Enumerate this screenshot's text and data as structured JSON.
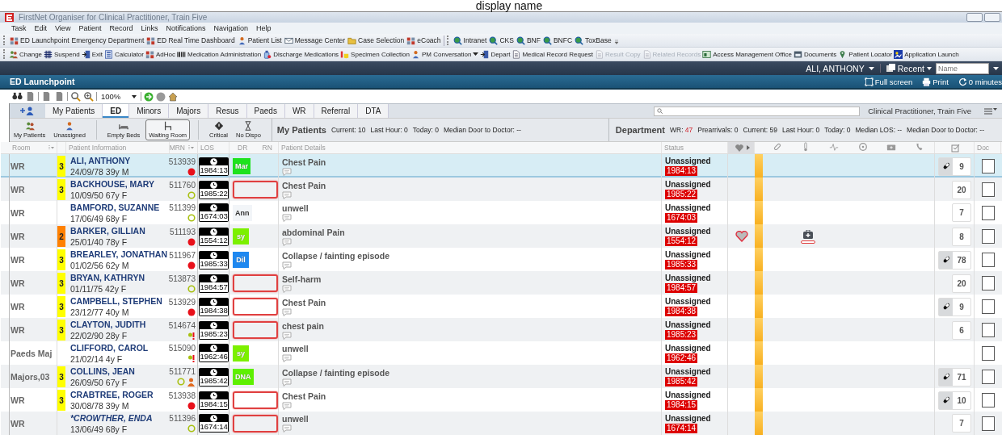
{
  "overlay_text": "display name",
  "window": {
    "title": "FirstNet Organiser for Clinical Practitioner, Train Five"
  },
  "menu": [
    "Task",
    "Edit",
    "View",
    "Patient",
    "Record",
    "Links",
    "Notifications",
    "Navigation",
    "Help"
  ],
  "toolbar_1": [
    {
      "items": [
        {
          "label": "ED Launchpoint",
          "kind": "grid"
        },
        {
          "label": "Emergency Department",
          "kind": "none"
        },
        {
          "label": "ED Real Time Dashboard",
          "kind": "grid"
        },
        {
          "label": "Patient List",
          "kind": "person"
        },
        {
          "label": "Message Center",
          "kind": "mail"
        },
        {
          "label": "Case Selection",
          "kind": "folder"
        },
        {
          "label": "eCoach",
          "kind": "grid"
        }
      ]
    },
    {
      "items": [
        {
          "label": "Intranet",
          "kind": "globe"
        },
        {
          "label": "CKS",
          "kind": "globe"
        },
        {
          "label": "BNF",
          "kind": "globe"
        },
        {
          "label": "BNFC",
          "kind": "globe"
        },
        {
          "label": "ToxBase",
          "kind": "globe"
        }
      ]
    }
  ],
  "toolbar_2": [
    {
      "label": "Change",
      "kind": "people",
      "disabled": false
    },
    {
      "label": "Suspend",
      "kind": "hash",
      "disabled": false
    },
    {
      "label": "Exit",
      "kind": "door",
      "disabled": false
    },
    {
      "label": "Calculator",
      "kind": "calculator",
      "disabled": false
    },
    {
      "label": "AdHoc",
      "kind": "grid",
      "disabled": false
    },
    {
      "label": "Medication Administration",
      "kind": "barcode",
      "disabled": false
    },
    {
      "label": "Discharge Medications",
      "kind": "bottle",
      "disabled": false
    },
    {
      "label": "Specimen Collection",
      "kind": "tube",
      "disabled": false
    },
    {
      "label": "PM Conversation",
      "kind": "person",
      "disabled": false,
      "dropdown": true
    },
    {
      "label": "Depart",
      "kind": "door",
      "disabled": false
    },
    {
      "label": "Medical Record Request",
      "kind": "document",
      "disabled": false
    },
    {
      "label": "Result Copy",
      "kind": "document",
      "disabled": true
    },
    {
      "label": "Related Records",
      "kind": "document",
      "disabled": true
    },
    {
      "label": "Access Management Office",
      "kind": "window",
      "disabled": false
    },
    {
      "label": "Documents",
      "kind": "drawer",
      "disabled": false
    },
    {
      "label": "Patient Locator",
      "kind": "pin",
      "disabled": false
    },
    {
      "label": "Application Launch",
      "kind": "tile",
      "disabled": false
    }
  ],
  "user_bar": {
    "user": "ALI, ANTHONY",
    "recent": "Recent",
    "search": {
      "placeholder": "Name"
    }
  },
  "view": {
    "title": "ED Launchpoint",
    "actions": [
      {
        "label": "Full screen",
        "kind": "fullscreen"
      },
      {
        "label": "Print",
        "kind": "print"
      },
      {
        "label": "0 minutes",
        "kind": "refresh"
      }
    ]
  },
  "zoom": "100%",
  "tabs": [
    {
      "label": "My Patients",
      "selected": false
    },
    {
      "label": "ED",
      "selected": true
    },
    {
      "label": "Minors",
      "selected": false
    },
    {
      "label": "Majors",
      "selected": false
    },
    {
      "label": "Resus",
      "selected": false
    },
    {
      "label": "Paeds",
      "selected": false
    },
    {
      "label": "WR",
      "selected": false
    },
    {
      "label": "Referral",
      "selected": false
    },
    {
      "label": "DTA",
      "selected": false
    }
  ],
  "account": "Clinical Practitioner, Train Five",
  "filters": [
    {
      "items": [
        {
          "label": "My Patients",
          "kind": "people",
          "selected": false
        },
        {
          "label": "Unassigned",
          "kind": "person",
          "selected": false
        }
      ]
    },
    {
      "items": [
        {
          "label": "Empty Beds",
          "kind": "bed",
          "selected": false
        },
        {
          "label": "Waiting Room",
          "kind": "chair",
          "selected": true
        }
      ]
    },
    {
      "items": [
        {
          "label": "Critical",
          "kind": "diamond",
          "selected": false
        },
        {
          "label": "No Dispo",
          "kind": "hourglass",
          "selected": false
        }
      ]
    }
  ],
  "my_patients": {
    "title": "My Patients",
    "stats": [
      {
        "label": "Current:",
        "value": "10",
        "alert": false
      },
      {
        "label": "Last Hour:",
        "value": "0",
        "alert": false
      },
      {
        "label": "Today:",
        "value": "0",
        "alert": false
      },
      {
        "label": "Median Door to Doctor:",
        "value": "--",
        "alert": false
      }
    ]
  },
  "department": {
    "title": "Department",
    "stats": [
      {
        "label": "WR:",
        "value": "47",
        "alert": true
      },
      {
        "label": "Prearrivals:",
        "value": "0",
        "alert": false
      },
      {
        "label": "Current:",
        "value": "59",
        "alert": false
      },
      {
        "label": "Last Hour:",
        "value": "0",
        "alert": false
      },
      {
        "label": "Today:",
        "value": "0",
        "alert": false
      },
      {
        "label": "Median LOS:",
        "value": "--",
        "alert": false
      },
      {
        "label": "Median Door to Doctor:",
        "value": "--",
        "alert": false
      }
    ]
  },
  "columns": {
    "room": "Room",
    "patient": "Patient Information",
    "mrn": "MRN",
    "los": "LOS",
    "dr": "DR",
    "rn": "RN",
    "details": "Patient Details",
    "status": "Status",
    "doc": "Doc"
  },
  "rows": [
    {
      "room": "WR",
      "acuity": {
        "label": "3",
        "color": "#ffff00"
      },
      "name": "ALI, ANTHONY",
      "italic": false,
      "dob": "24/09/78 39y M",
      "mrn": "513939",
      "indicators": [
        {
          "kind": "dot"
        }
      ],
      "los": "1984:13",
      "dr": {
        "kind": "tag",
        "label": "Mar",
        "color": "#1ee21e"
      },
      "complaint": "Chest Pain",
      "status": "Unassigned",
      "status_time": "1984:13",
      "heart": false,
      "kit": false,
      "count": {
        "label": "9",
        "pill": true
      },
      "doc_checked": false,
      "selected": true
    },
    {
      "room": "WR",
      "acuity": {
        "label": "3",
        "color": "#ffff00"
      },
      "name": "BACKHOUSE, MARY",
      "italic": false,
      "dob": "10/09/50 67y F",
      "mrn": "511760",
      "indicators": [
        {
          "kind": "ring"
        }
      ],
      "los": "1985:22",
      "dr": {
        "kind": "empty"
      },
      "complaint": "Chest Pain",
      "status": "Unassigned",
      "status_time": "1985:22",
      "heart": false,
      "kit": false,
      "count": {
        "label": "20",
        "pill": false
      },
      "doc_checked": false,
      "selected": false
    },
    {
      "room": "WR",
      "name": "BAMFORD, SUZANNE",
      "italic": false,
      "dob": "17/06/49 68y F",
      "mrn": "511399",
      "indicators": [
        {
          "kind": "ring"
        }
      ],
      "los": "1674:03",
      "dr": {
        "kind": "tag",
        "label": "Ann",
        "color": "#f2f5f8"
      },
      "complaint": "unwell",
      "status": "Unassigned",
      "status_time": "1674:03",
      "heart": false,
      "kit": false,
      "count": {
        "label": "7",
        "pill": false
      },
      "doc_checked": false,
      "selected": false
    },
    {
      "room": "WR",
      "acuity": {
        "label": "2",
        "color": "#ff8000"
      },
      "name": "BARKER, GILLIAN",
      "italic": false,
      "dob": "25/01/40 78y F",
      "mrn": "511193",
      "indicators": [
        {
          "kind": "dot"
        }
      ],
      "los": "1554:12",
      "dr": {
        "kind": "tag",
        "label": "sy",
        "color": "#7cf000"
      },
      "complaint": "abdominal Pain",
      "status": "Unassigned",
      "status_time": "1554:12",
      "heart": true,
      "kit": true,
      "count": {
        "label": "8",
        "pill": false
      },
      "doc_checked": false,
      "selected": false
    },
    {
      "room": "WR",
      "acuity": {
        "label": "3",
        "color": "#ffff00"
      },
      "name": "BREARLEY, JONATHAN",
      "italic": false,
      "dob": "01/02/56 62y M",
      "mrn": "511967",
      "indicators": [
        {
          "kind": "dot"
        }
      ],
      "los": "1985:33",
      "dr": {
        "kind": "tag",
        "label": "Dil",
        "color": "#1e88f0"
      },
      "complaint": "Collapse / fainting episode",
      "status": "Unassigned",
      "status_time": "1985:33",
      "heart": false,
      "kit": false,
      "count": {
        "label": "78",
        "pill": true
      },
      "doc_checked": false,
      "selected": false
    },
    {
      "room": "WR",
      "acuity": {
        "label": "3",
        "color": "#ffff00"
      },
      "name": "BRYAN, KATHRYN",
      "italic": false,
      "dob": "01/11/75 42y F",
      "mrn": "513873",
      "indicators": [
        {
          "kind": "ring"
        }
      ],
      "los": "1984:57",
      "dr": {
        "kind": "empty"
      },
      "complaint": "Self-harm",
      "status": "Unassigned",
      "status_time": "1984:57",
      "heart": false,
      "kit": false,
      "count": {
        "label": "20",
        "pill": false
      },
      "doc_checked": false,
      "selected": false
    },
    {
      "room": "WR",
      "acuity": {
        "label": "3",
        "color": "#ffff00"
      },
      "name": "CAMPBELL, STEPHEN",
      "italic": false,
      "dob": "23/12/77 40y M",
      "mrn": "513929",
      "indicators": [
        {
          "kind": "dot"
        }
      ],
      "los": "1984:38",
      "dr": {
        "kind": "empty"
      },
      "complaint": "Chest Pain",
      "status": "Unassigned",
      "status_time": "1984:38",
      "heart": false,
      "kit": false,
      "count": {
        "label": "9",
        "pill": true
      },
      "doc_checked": false,
      "selected": false
    },
    {
      "room": "WR",
      "acuity": {
        "label": "3",
        "color": "#ffff00"
      },
      "name": "CLAYTON, JUDITH",
      "italic": false,
      "dob": "22/02/90 28y F",
      "mrn": "514674",
      "indicators": [
        {
          "kind": "alert"
        }
      ],
      "los": "1985:23",
      "dr": {
        "kind": "empty"
      },
      "complaint": "chest pain",
      "status": "Unassigned",
      "status_time": "1985:23",
      "heart": false,
      "kit": false,
      "count": {
        "label": "6",
        "pill": false
      },
      "doc_checked": false,
      "selected": false
    },
    {
      "room": "Paeds Maj",
      "name": "CLIFFORD, CAROL",
      "italic": false,
      "dob": "21/02/14 4y F",
      "mrn": "515090",
      "indicators": [
        {
          "kind": "alert"
        }
      ],
      "los": "1962:46",
      "dr": {
        "kind": "tag",
        "label": "sy",
        "color": "#7cf000"
      },
      "complaint": "unwell",
      "status": "Unassigned",
      "status_time": "1962:46",
      "heart": false,
      "kit": false,
      "doc_checked": false,
      "selected": false
    },
    {
      "room": "Majors,03",
      "acuity": {
        "label": "3",
        "color": "#ffff00"
      },
      "name": "COLLINS, JEAN",
      "italic": false,
      "dob": "26/09/50 67y F",
      "mrn": "511771",
      "indicators": [
        {
          "kind": "ring"
        },
        {
          "kind": "person"
        }
      ],
      "los": "1985:42",
      "dr": {
        "kind": "tag",
        "label": "DNA",
        "color": "#5ef000"
      },
      "complaint": "Collapse / fainting episode",
      "status": "Unassigned",
      "status_time": "1985:42",
      "heart": false,
      "kit": false,
      "count": {
        "label": "71",
        "pill": true
      },
      "doc_checked": false,
      "selected": false
    },
    {
      "room": "WR",
      "acuity": {
        "label": "3",
        "color": "#ffff00"
      },
      "name": "CRABTREE, ROGER",
      "italic": false,
      "dob": "30/08/78 39y M",
      "mrn": "513938",
      "indicators": [
        {
          "kind": "dot"
        }
      ],
      "los": "1984:15",
      "dr": {
        "kind": "empty"
      },
      "complaint": "Chest Pain",
      "status": "Unassigned",
      "status_time": "1984:15",
      "heart": false,
      "kit": false,
      "count": {
        "label": "10",
        "pill": true
      },
      "doc_checked": false,
      "selected": false
    },
    {
      "room": "WR",
      "name": "*CROWTHER, ENDA",
      "italic": true,
      "dob": "13/06/49 68y F",
      "mrn": "511396",
      "indicators": [
        {
          "kind": "ring"
        }
      ],
      "los": "1674:14",
      "dr": {
        "kind": "empty"
      },
      "complaint": "unwell",
      "status": "Unassigned",
      "status_time": "1674:14",
      "heart": false,
      "kit": false,
      "count": {
        "label": "7",
        "pill": false
      },
      "doc_checked": false,
      "selected": false
    }
  ]
}
